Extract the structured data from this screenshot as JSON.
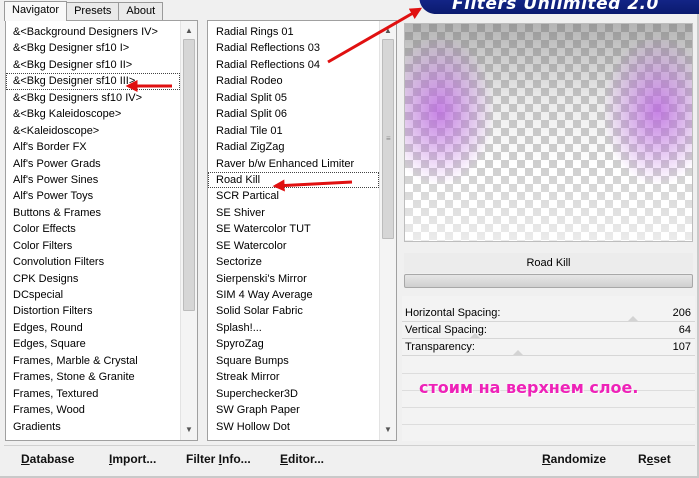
{
  "window": {
    "banner_title": "Filters Unlimited 2.0"
  },
  "tabs": [
    {
      "label": "Navigator",
      "active": true
    },
    {
      "label": "Presets",
      "active": false
    },
    {
      "label": "About",
      "active": false
    }
  ],
  "categories": {
    "items": [
      "&<Background Designers IV>",
      "&<Bkg Designer sf10 I>",
      "&<Bkg Designer sf10 II>",
      "&<Bkg Designer sf10 III>",
      "&<Bkg Designers sf10 IV>",
      "&<Bkg Kaleidoscope>",
      "&<Kaleidoscope>",
      "Alf's Border FX",
      "Alf's Power Grads",
      "Alf's Power Sines",
      "Alf's Power Toys",
      "Buttons & Frames",
      "Color Effects",
      "Color Filters",
      "Convolution Filters",
      "CPK Designs",
      "DCspecial",
      "Distortion Filters",
      "Edges, Round",
      "Edges, Square",
      "Frames, Marble & Crystal",
      "Frames, Stone & Granite",
      "Frames, Textured",
      "Frames, Wood",
      "Gradients"
    ],
    "selected_index": 3
  },
  "filters": {
    "items": [
      "Radial  Rings 01",
      "Radial Reflections 03",
      "Radial Reflections 04",
      "Radial Rodeo",
      "Radial Split 05",
      "Radial Split 06",
      "Radial Tile 01",
      "Radial ZigZag",
      "Raver b/w Enhanced Limiter",
      "Road Kill",
      "SCR  Partical",
      "SE Shiver",
      "SE Watercolor TUT",
      "SE Watercolor",
      "Sectorize",
      "Sierpenski's Mirror",
      "SIM 4 Way Average",
      "Solid Solar Fabric",
      "Splash!...",
      "SpyroZag",
      "Square Bumps",
      "Streak Mirror",
      "Superchecker3D",
      "SW Graph Paper",
      "SW Hollow Dot"
    ],
    "selected_index": 9
  },
  "preview": {
    "filter_name": "Road Kill"
  },
  "params": [
    {
      "label": "Horizontal Spacing:",
      "value": "206"
    },
    {
      "label": "Vertical Spacing:",
      "value": "64"
    },
    {
      "label": "Transparency:",
      "value": "107"
    }
  ],
  "annotation": {
    "text": "стоим на верхнем слое."
  },
  "buttons": {
    "database": {
      "pre": "",
      "u": "D",
      "post": "atabase"
    },
    "import": {
      "pre": "",
      "u": "I",
      "post": "mport..."
    },
    "filter_info": {
      "pre": "Filter ",
      "u": "I",
      "post": "nfo..."
    },
    "editor": {
      "pre": "",
      "u": "E",
      "post": "ditor..."
    },
    "randomize": {
      "pre": "",
      "u": "R",
      "post": "andomize"
    },
    "reset": {
      "pre": "R",
      "u": "e",
      "post": "set"
    }
  },
  "colors": {
    "banner": "#1c2f9e",
    "arrow": "#e01010",
    "annotation": "#ee22b8",
    "preview_glow": "#b95fe1"
  }
}
